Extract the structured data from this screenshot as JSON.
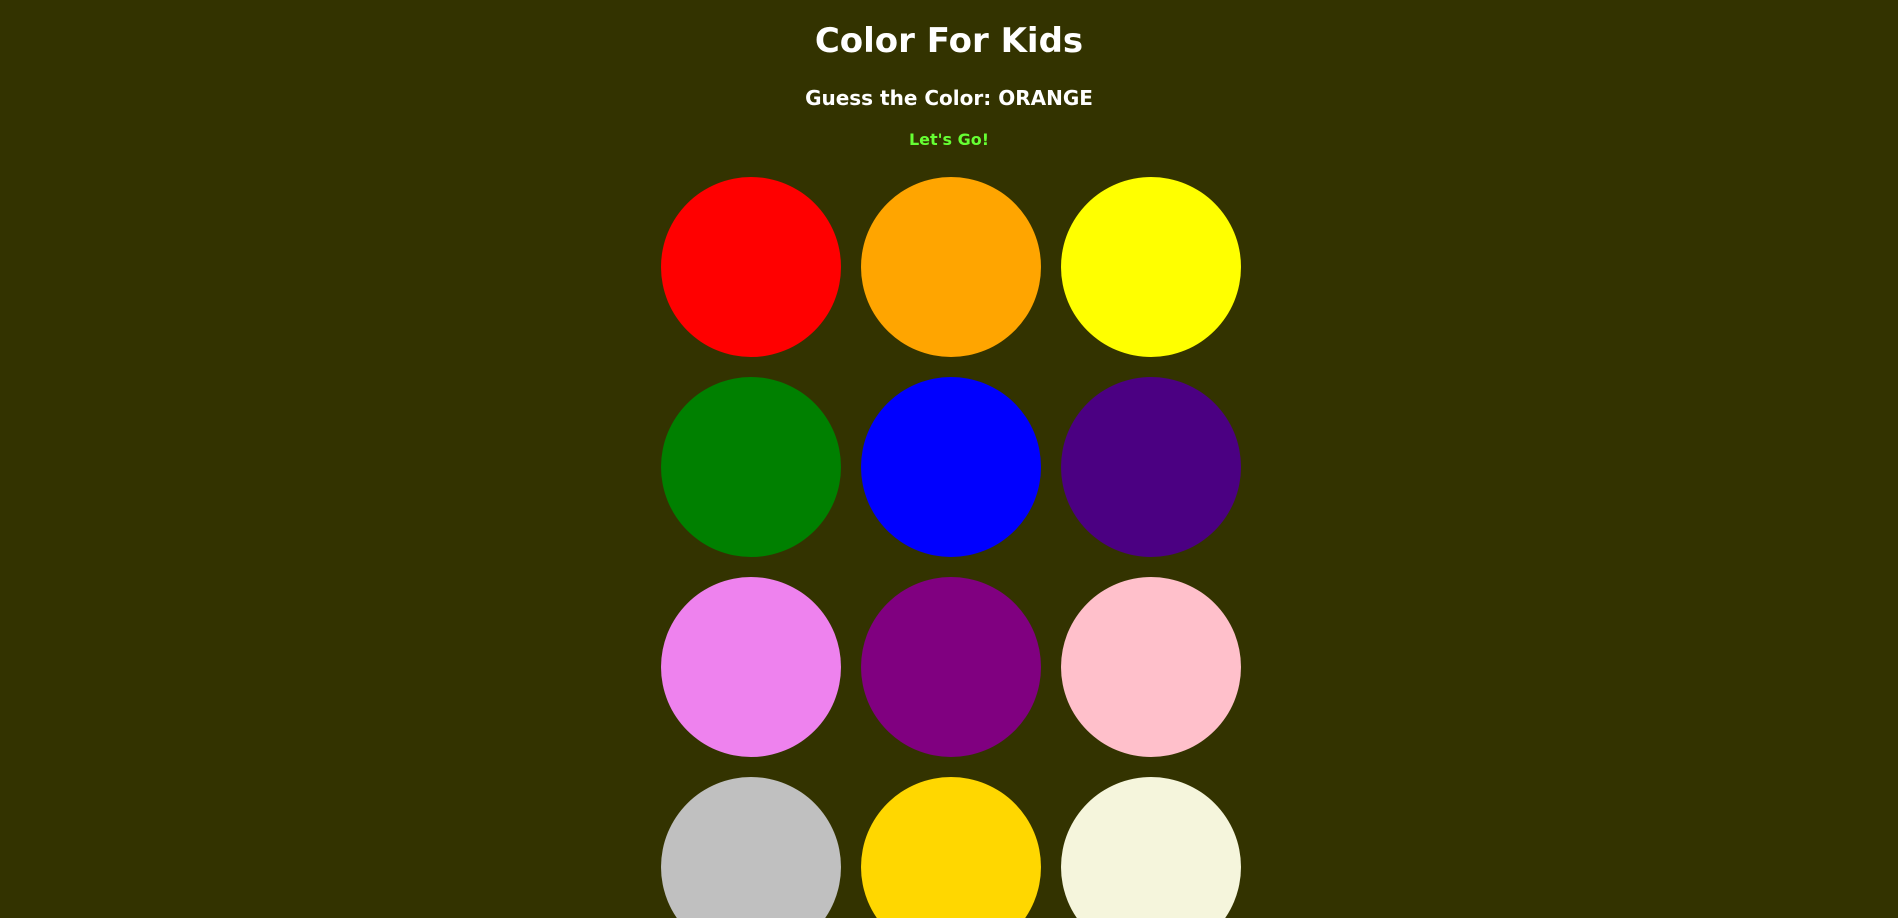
{
  "header": {
    "title": "Color For Kids",
    "prompt": "Guess the Color: ORANGE",
    "feedback": "Let's Go!"
  },
  "colors": {
    "background": "#333300",
    "title_text": "#ffffff",
    "feedback_text": "#66ff33"
  },
  "swatches": [
    {
      "name": "red",
      "color": "#ff0000"
    },
    {
      "name": "orange",
      "color": "#ffa500"
    },
    {
      "name": "yellow",
      "color": "#ffff00"
    },
    {
      "name": "green",
      "color": "#008000"
    },
    {
      "name": "blue",
      "color": "#0000ff"
    },
    {
      "name": "indigo",
      "color": "#4b0082"
    },
    {
      "name": "violet",
      "color": "#ee82ee"
    },
    {
      "name": "purple",
      "color": "#800080"
    },
    {
      "name": "pink",
      "color": "#ffc0cb"
    },
    {
      "name": "silver",
      "color": "#c0c0c0"
    },
    {
      "name": "gold",
      "color": "#ffd700"
    },
    {
      "name": "beige",
      "color": "#f5f5dc"
    }
  ]
}
